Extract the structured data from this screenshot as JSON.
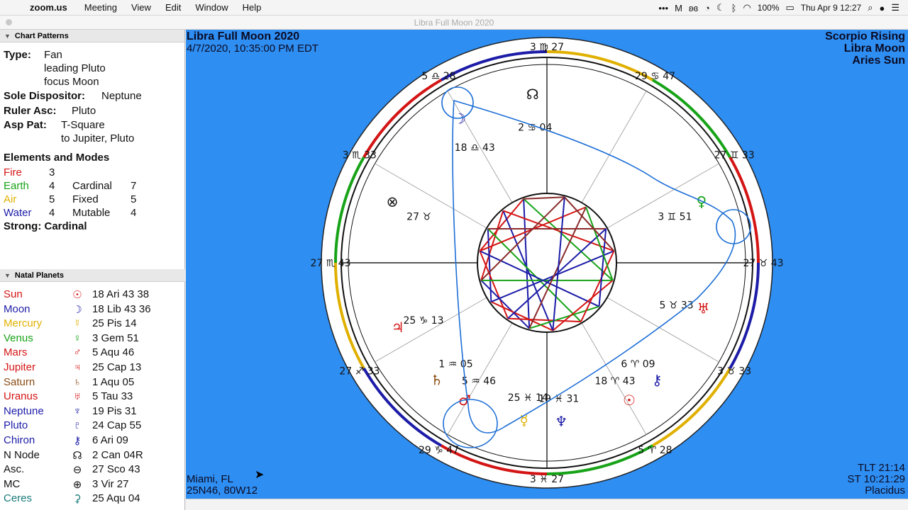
{
  "menubar": {
    "apple": "",
    "app_name": "zoom.us",
    "menus": [
      "Meeting",
      "View",
      "Edit",
      "Window",
      "Help"
    ],
    "battery": "100%",
    "clock": "Thu Apr 9  12:27"
  },
  "window": {
    "title": "Libra Full Moon 2020"
  },
  "chart_patterns": {
    "header": "Chart Patterns",
    "type_label": "Type:",
    "type_value": "Fan",
    "type_line2": "leading Pluto",
    "type_line3": "focus Moon",
    "sole_label": "Sole Dispositor:",
    "sole_value": "Neptune",
    "ruler_label": "Ruler Asc:",
    "ruler_value": "Pluto",
    "asp_label": "Asp Pat:",
    "asp_value": "T-Square",
    "asp_line2": "to Jupiter, Pluto",
    "elements_header": "Elements and Modes",
    "elements": [
      {
        "name": "Fire",
        "count": "3",
        "color": "#d41414"
      },
      {
        "name": "Earth",
        "count": "4",
        "color": "#17a317",
        "mode": "Cardinal",
        "mode_count": "7"
      },
      {
        "name": "Air",
        "count": "5",
        "color": "#e0b000",
        "mode": "Fixed",
        "mode_count": "5"
      },
      {
        "name": "Water",
        "count": "4",
        "color": "#1c1ca8",
        "mode": "Mutable",
        "mode_count": "4"
      }
    ],
    "strong": "Strong: Cardinal"
  },
  "natal_planets": {
    "header": "Natal Planets",
    "rows": [
      {
        "name": "Sun",
        "glyph": "☉",
        "pos": "18 Ari 43 38",
        "color": "#d41414"
      },
      {
        "name": "Moon",
        "glyph": "☽",
        "pos": "18 Lib 43 36",
        "color": "#1c1ca8"
      },
      {
        "name": "Mercury",
        "glyph": "☿",
        "pos": "25 Pis 14",
        "color": "#e0b000"
      },
      {
        "name": "Venus",
        "glyph": "♀",
        "pos": "3 Gem 51",
        "color": "#17a317"
      },
      {
        "name": "Mars",
        "glyph": "♂",
        "pos": "5 Aqu 46",
        "color": "#d41414"
      },
      {
        "name": "Jupiter",
        "glyph": "♃",
        "pos": "25 Cap 13",
        "color": "#d41414"
      },
      {
        "name": "Saturn",
        "glyph": "♄",
        "pos": "1 Aqu 05",
        "color": "#8a4a12"
      },
      {
        "name": "Uranus",
        "glyph": "♅",
        "pos": "5 Tau 33",
        "color": "#d41414"
      },
      {
        "name": "Neptune",
        "glyph": "♆",
        "pos": "19 Pis 31",
        "color": "#1c1ca8"
      },
      {
        "name": "Pluto",
        "glyph": "♇",
        "pos": "24 Cap 55",
        "color": "#1c1ca8"
      },
      {
        "name": "Chiron",
        "glyph": "⚷",
        "pos": "6 Ari 09",
        "color": "#1c1ca8"
      },
      {
        "name": "N Node",
        "glyph": "☊",
        "pos": "2 Can 04R",
        "color": "#111111"
      },
      {
        "name": "Asc.",
        "glyph": "⊖",
        "pos": "27 Sco 43",
        "color": "#111111"
      },
      {
        "name": "MC",
        "glyph": "⊕",
        "pos": "3 Vir 27",
        "color": "#111111"
      },
      {
        "name": "Ceres",
        "glyph": "⚳",
        "pos": "25 Aqu 04",
        "color": "#1a7a7a"
      }
    ]
  },
  "chart": {
    "title": "Libra Full Moon 2020",
    "datetime": "4/7/2020, 10:35:00 PM EDT",
    "top_right": [
      "Scorpio Rising",
      "Libra Moon",
      "Aries Sun"
    ],
    "location": "Miami, FL",
    "coords": "25N46, 80W12",
    "bottom_right": [
      "TLT 21:14",
      "ST 10:21:29",
      "Placidus"
    ],
    "cusps": [
      {
        "deg": "27",
        "sign": "♏",
        "min": "43"
      },
      {
        "deg": "27",
        "sign": "♐",
        "min": "33"
      },
      {
        "deg": "29",
        "sign": "♑",
        "min": "47"
      },
      {
        "deg": "3",
        "sign": "♓",
        "min": "27"
      },
      {
        "deg": "5",
        "sign": "♈",
        "min": "28"
      },
      {
        "deg": "3",
        "sign": "♉",
        "min": "33"
      },
      {
        "deg": "27",
        "sign": "♉",
        "min": "43"
      },
      {
        "deg": "27",
        "sign": "♊",
        "min": "33"
      },
      {
        "deg": "29",
        "sign": "♋",
        "min": "47"
      },
      {
        "deg": "3",
        "sign": "♍",
        "min": "27"
      },
      {
        "deg": "5",
        "sign": "♎",
        "min": "28"
      },
      {
        "deg": "3",
        "sign": "♏",
        "min": "33"
      }
    ],
    "placements": [
      {
        "glyph": "♀",
        "text": "3 ♊ 51",
        "color": "#17a317"
      },
      {
        "glyph": "♃",
        "text": "25 ♑ 13",
        "color": "#d41414"
      },
      {
        "glyph": "♄",
        "text": "1 ♒ 05",
        "color": "#8a4a12"
      },
      {
        "glyph": "♂",
        "text": "5 ♒ 46",
        "color": "#d41414"
      },
      {
        "glyph": "☿",
        "text": "25 ♓ 14",
        "color": "#e0b000"
      },
      {
        "glyph": "♆",
        "text": "19 ♓ 31",
        "color": "#1c1ca8"
      },
      {
        "glyph": "☉",
        "text": "18 ♈ 43",
        "color": "#d41414"
      },
      {
        "glyph": "⚷",
        "text": "6 ♈ 09",
        "color": "#1c1ca8"
      },
      {
        "glyph": "☽",
        "text": "18 ♎ 43",
        "color": "#1c1ca8"
      },
      {
        "glyph": "♅",
        "text": "5 ♉ 33",
        "color": "#d41414"
      },
      {
        "glyph": "☊",
        "text": "2 ♋ 04",
        "color": "#111111"
      },
      {
        "glyph": "⊗",
        "text": "27 ♉",
        "color": "#111111"
      }
    ]
  }
}
